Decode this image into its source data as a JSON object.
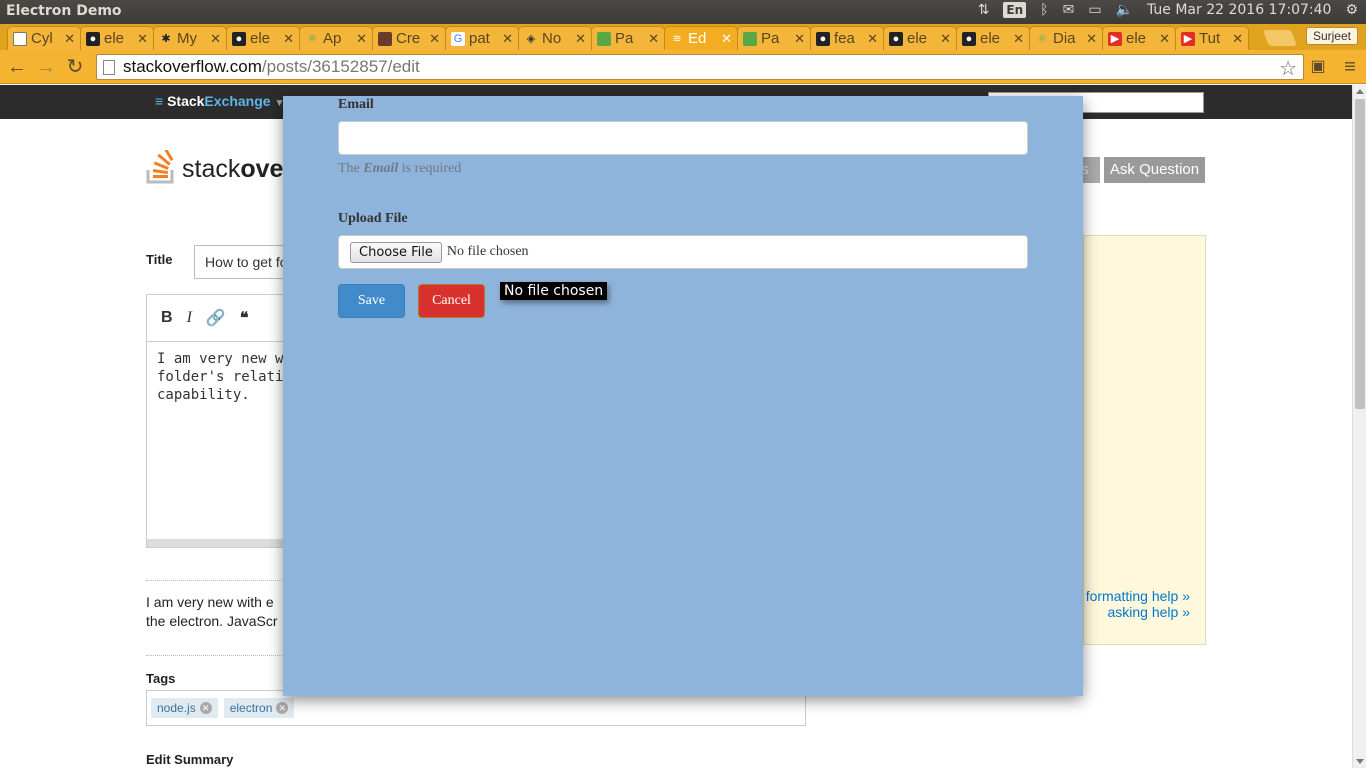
{
  "os": {
    "window_title": "Electron Demo",
    "language": "En",
    "datetime": "Tue Mar 22 2016 17:07:40"
  },
  "browser": {
    "tabs": [
      {
        "label": "Cyl",
        "icon": "page-icon"
      },
      {
        "label": "ele",
        "icon": "github-icon"
      },
      {
        "label": "My",
        "icon": "bug-icon"
      },
      {
        "label": "ele",
        "icon": "github-icon"
      },
      {
        "label": "Ap",
        "icon": "atom-icon"
      },
      {
        "label": "Cre",
        "icon": "image-icon"
      },
      {
        "label": "pat",
        "icon": "google-icon"
      },
      {
        "label": "No",
        "icon": "diamond-icon"
      },
      {
        "label": "Pa",
        "icon": "cube-icon"
      },
      {
        "label": "Ed",
        "icon": "stackoverflow-icon",
        "active": true
      },
      {
        "label": "Pa",
        "icon": "cube-icon"
      },
      {
        "label": "fea",
        "icon": "github-icon"
      },
      {
        "label": "ele",
        "icon": "github-icon"
      },
      {
        "label": "ele",
        "icon": "github-icon"
      },
      {
        "label": "Dia",
        "icon": "atom-icon"
      },
      {
        "label": "ele",
        "icon": "youtube-icon"
      },
      {
        "label": "Tut",
        "icon": "youtube-icon"
      }
    ],
    "profile_name": "Surjeet",
    "url_domain": "stackoverflow.com",
    "url_path": "/posts/36152857/edit"
  },
  "page": {
    "se_brand_a": "Stack",
    "se_brand_b": "Exchange",
    "so_word_a": "stack",
    "so_word_b": "over",
    "users_button": "s",
    "ask_question": "Ask Question",
    "title_label": "Title",
    "title_value": "How to get fo",
    "editor_text": "I am very new w\nfolder's relati\ncapability.",
    "preview_line1": "I am very new with e",
    "preview_line2": "the electron. JavaScr",
    "tags_label": "Tags",
    "tags": [
      "node.js",
      "electron"
    ],
    "edit_summary_label": "Edit Summary",
    "formatting_help": "formatting help »",
    "asking_help": "asking help »"
  },
  "modal": {
    "email_label": "Email",
    "email_value": "",
    "email_help_prefix": "The ",
    "email_help_field": "Email",
    "email_help_suffix": " is required",
    "upload_label": "Upload File",
    "choose_file_button": "Choose File",
    "no_file_text": "No file chosen",
    "save_button": "Save",
    "cancel_button": "Cancel",
    "tooltip_text": "No file chosen"
  },
  "colors": {
    "modal_bg": "#8fb4db",
    "save_button": "#428bca",
    "cancel_button": "#d9312e",
    "tab_strip": "#e0a31e"
  }
}
